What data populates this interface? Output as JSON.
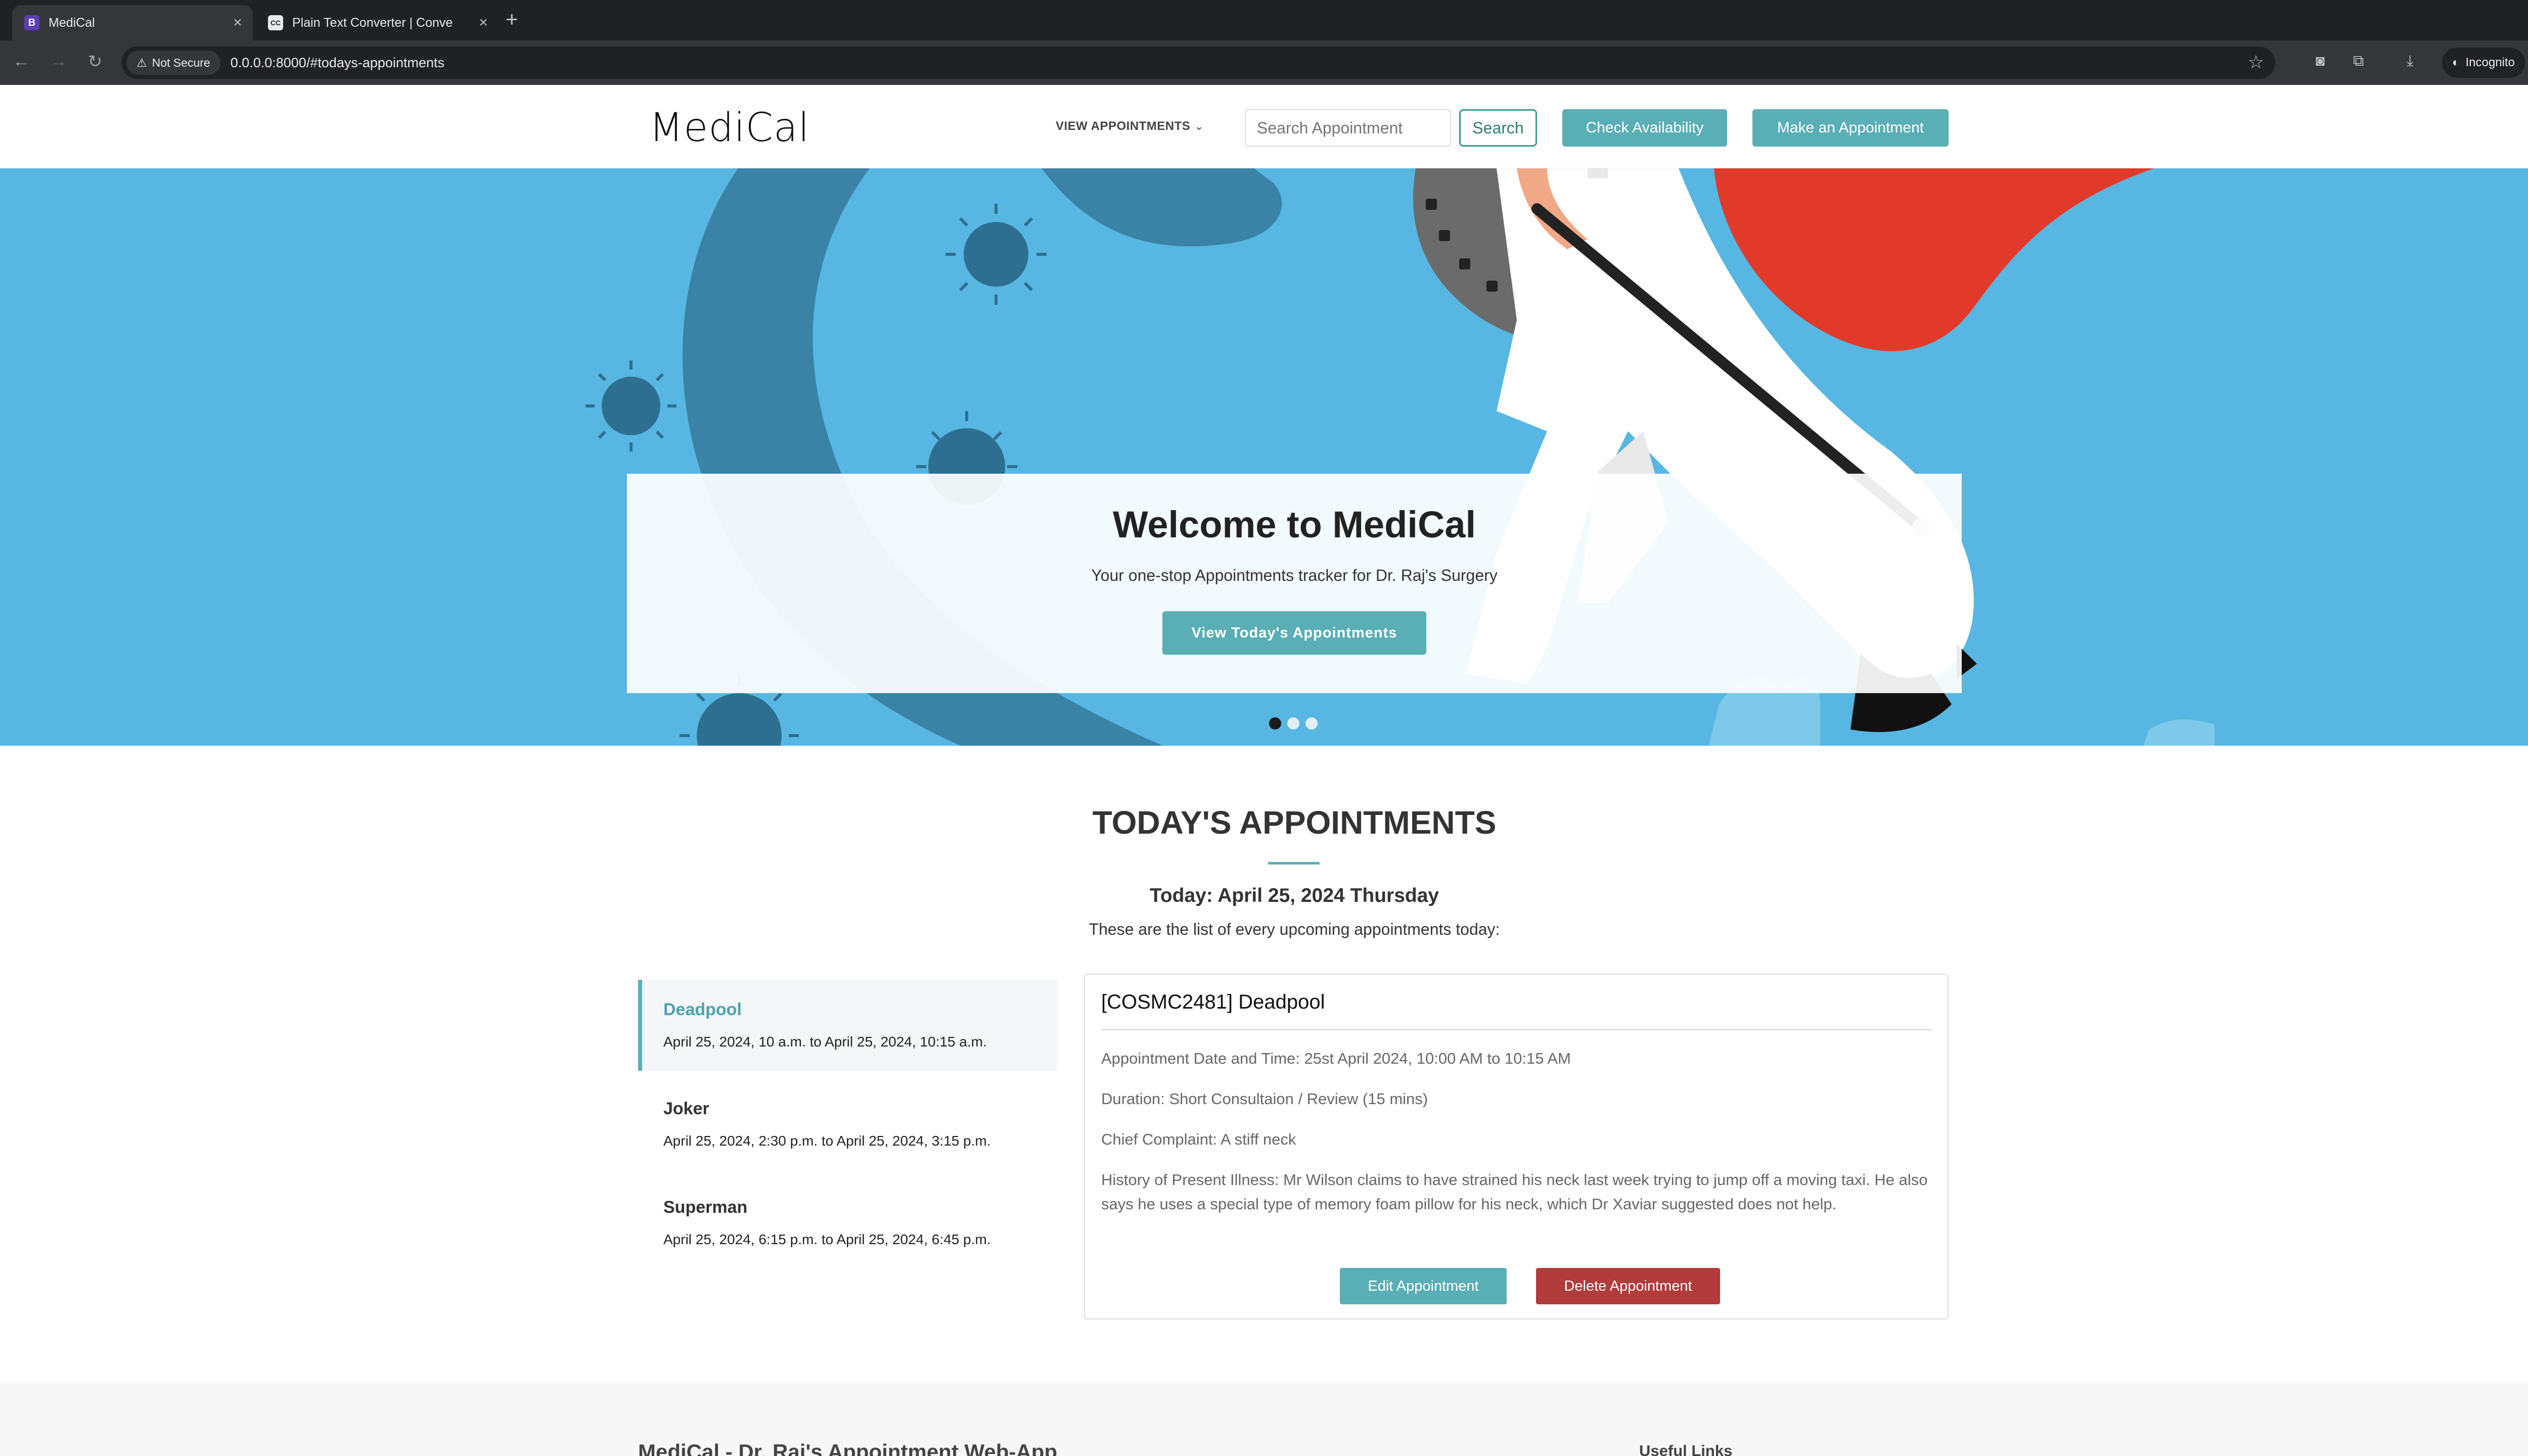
{
  "browser": {
    "tabs": [
      {
        "title": "MediCal",
        "favicon": "B",
        "active": true
      },
      {
        "title": "Plain Text Converter | Conve",
        "favicon": "CC",
        "active": false
      }
    ],
    "security_label": "Not Secure",
    "url": "0.0.0.0:8000/#todays-appointments",
    "incognito_label": "Incognito"
  },
  "header": {
    "logo": "MediCal",
    "nav_view": "VIEW APPOINTMENTS",
    "search_placeholder": "Search Appointment",
    "search_button": "Search",
    "check_availability": "Check Availability",
    "make_appointment": "Make an Appointment"
  },
  "hero": {
    "title": "Welcome to MediCal",
    "subtitle": "Your one-stop Appointments tracker for Dr. Raj's Surgery",
    "button": "View Today's Appointments",
    "slide_count": 3,
    "active_slide": 1
  },
  "appointments": {
    "title": "TODAY'S APPOINTMENTS",
    "today": "Today: April 25, 2024 Thursday",
    "description": "These are the list of every upcoming appointments today:",
    "list": [
      {
        "name": "Deadpool",
        "time": "April 25, 2024, 10 a.m. to April 25, 2024, 10:15 a.m.",
        "active": true
      },
      {
        "name": "Joker",
        "time": "April 25, 2024, 2:30 p.m. to April 25, 2024, 3:15 p.m.",
        "active": false
      },
      {
        "name": "Superman",
        "time": "April 25, 2024, 6:15 p.m. to April 25, 2024, 6:45 p.m.",
        "active": false
      }
    ],
    "detail": {
      "title": "[COSMC2481] Deadpool",
      "datetime": "Appointment Date and Time: 25st April 2024, 10:00 AM to 10:15 AM",
      "duration": "Duration: Short Consultaion / Review (15 mins)",
      "complaint": "Chief Complaint: A stiff neck",
      "history": "History of Present Illness: Mr Wilson claims to have strained his neck last week trying to jump off a moving taxi. He also says he uses a special type of memory foam pillow for his neck, which Dr Xaviar suggested does not help.",
      "edit_button": "Edit Appointment",
      "delete_button": "Delete Appointment"
    }
  },
  "footer": {
    "title": "MediCal - Dr. Raj's Appointment Web-App",
    "useful_links": "Useful Links"
  },
  "colors": {
    "accent": "#5aaeb5",
    "hero_bg": "#57b7e2",
    "danger": "#b23b3b"
  }
}
